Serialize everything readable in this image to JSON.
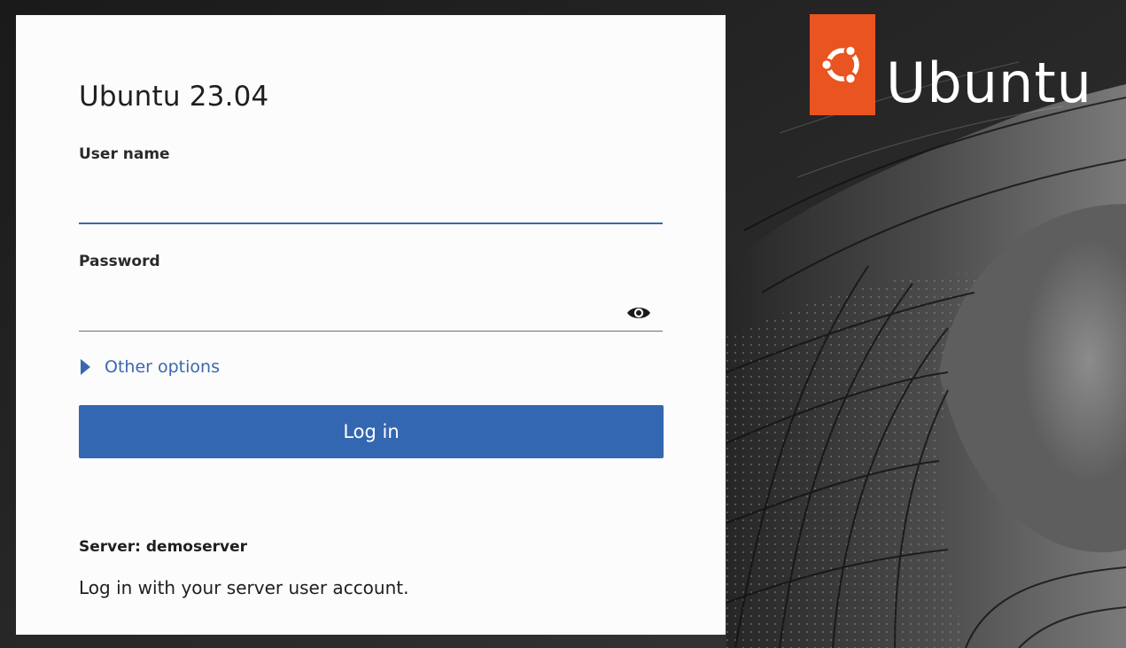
{
  "card": {
    "heading": "Ubuntu 23.04",
    "username": {
      "label": "User name",
      "value": "",
      "placeholder": ""
    },
    "password": {
      "label": "Password",
      "value": "",
      "placeholder": "",
      "reveal_icon": "eye-icon"
    },
    "other_options": {
      "label": "Other options",
      "icon": "expander-triangle-icon"
    },
    "login_button": "Log in",
    "server": "Server: demoserver",
    "help_text": "Log in with your server user account."
  },
  "brand": {
    "logo_icon": "ubuntu-circle-of-friends-icon",
    "wordmark": "Ubuntu",
    "logo_color": "#e95420"
  },
  "colors": {
    "accent": "#3467b1",
    "card_background": "#fcfcfc",
    "page_background": "#1e1e1e"
  }
}
